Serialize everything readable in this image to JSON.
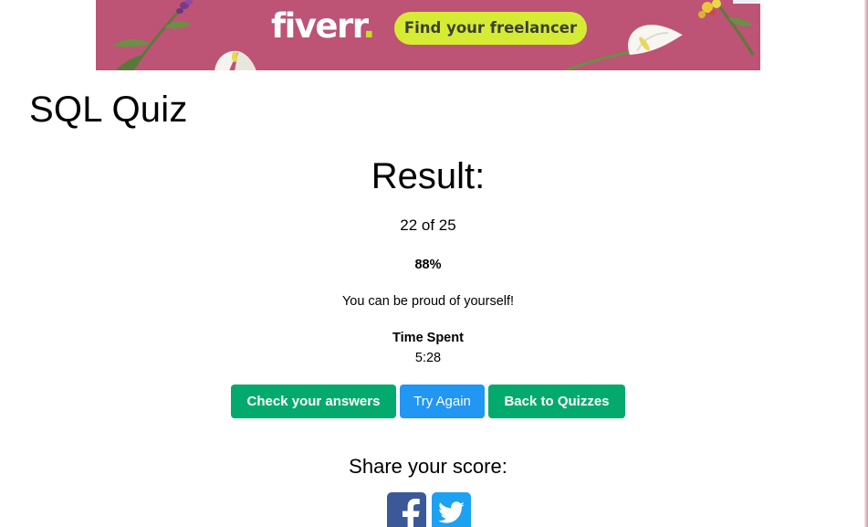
{
  "ad": {
    "brand": "fiverr",
    "brand_dot": ".",
    "cta": "Find your freelancer",
    "background_color": "#bd5375",
    "cta_color": "#d6ec34"
  },
  "page": {
    "title": "SQL Quiz"
  },
  "result": {
    "heading": "Result:",
    "score_text": "22 of 25",
    "percent_text": "88%",
    "message": "You can be proud of yourself!",
    "time_label": "Time Spent",
    "time_value": "5:28"
  },
  "buttons": {
    "check": "Check your answers",
    "try_again": "Try Again",
    "back": "Back to Quizzes"
  },
  "share": {
    "heading": "Share your score:",
    "icons": [
      "facebook-icon",
      "twitter-icon"
    ]
  },
  "colors": {
    "green": "#04aa6d",
    "blue": "#2196f3",
    "facebook": "#3b5998",
    "twitter": "#1da1f2"
  }
}
